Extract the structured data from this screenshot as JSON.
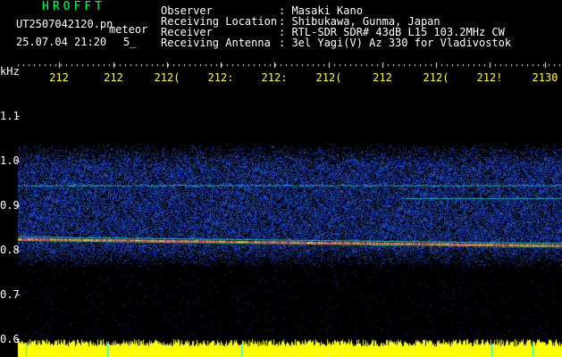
{
  "header": {
    "app_title": "HROFFT",
    "file_name": "UT2507042120.pn",
    "file_tag": "meteor",
    "datetime": "25.07.04 21:20",
    "scale_tag": "5_",
    "fields": [
      {
        "label": "Observer",
        "value": ": Masaki Kano"
      },
      {
        "label": "Receiving Location",
        "value": ": Shibukawa, Gunma, Japan"
      },
      {
        "label": "Receiver",
        "value": ": RTL-SDR SDR# 43dB L15 103.2MHz CW"
      },
      {
        "label": "Receiving Antenna",
        "value": ": 3el Yagi(V) Az 330 for Vladivostok"
      }
    ]
  },
  "time_axis": {
    "ticks": [
      "212",
      "212",
      "212(",
      "212:",
      "212:",
      "212(",
      "212",
      "212(",
      "212!",
      "2130"
    ]
  },
  "freq_axis": {
    "unit": "kHz",
    "ticks": [
      "1.1",
      "1.0",
      "0.9",
      "0.8",
      "0.7",
      "0.6"
    ]
  },
  "colors": {
    "background": "#000000",
    "header_text": "#ffffff",
    "app_title": "#00ff66",
    "time_ticks": "#ffff33",
    "noise_base": "#0a1a7a",
    "carrier_line": "#ff3030",
    "echo_line": "#20d0c0",
    "signal_bar": "#ffff00"
  }
}
